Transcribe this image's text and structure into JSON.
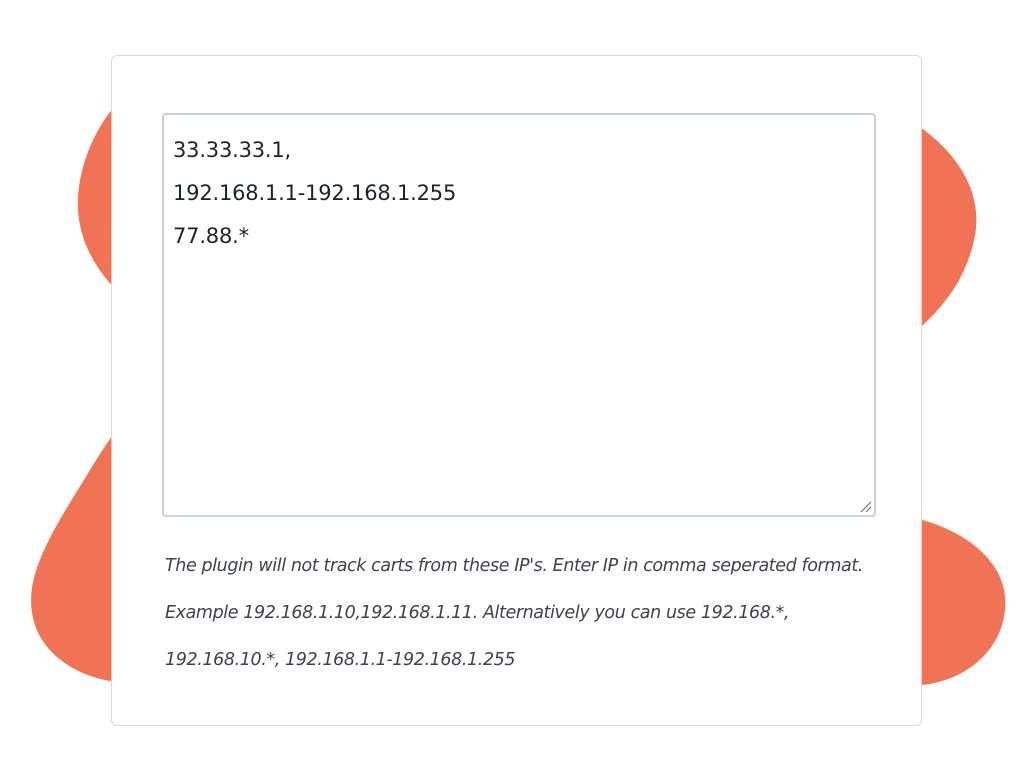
{
  "theme": {
    "accent_blob": "#f07355",
    "card_border": "#d9d9d9",
    "field_border": "#c8d0d8",
    "text": "#1d2327",
    "help_text": "#3c434a"
  },
  "ip_exclusion": {
    "lines": [
      "33.33.33.1,",
      "192.168.1.1-192.168.1.255",
      "77.88.*"
    ],
    "help_text": "The plugin will not track carts from these IP's. Enter IP in comma seperated format. Example 192.168.1.10,192.168.1.11. Alternatively you can use 192.168.*, 192.168.10.*, 192.168.1.1-192.168.1.255"
  }
}
